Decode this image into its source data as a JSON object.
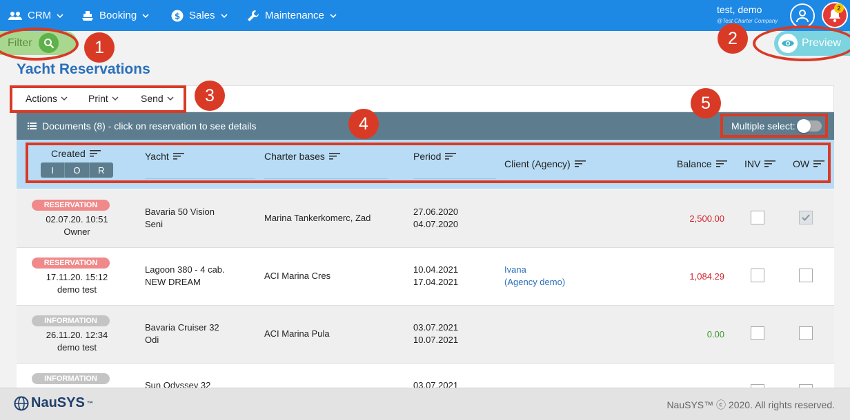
{
  "nav": {
    "items": [
      {
        "label": "CRM",
        "icon": "people-icon"
      },
      {
        "label": "Booking",
        "icon": "ship-icon"
      },
      {
        "label": "Sales",
        "icon": "dollar-icon"
      },
      {
        "label": "Maintenance",
        "icon": "wrench-icon"
      }
    ],
    "user_name": "test, demo",
    "user_company": "@Test Charter Company",
    "notification_count": "2"
  },
  "filter_label": "Filter",
  "preview_label": "Preview",
  "page_title": "Yacht Reservations",
  "toolbar": {
    "actions": "Actions",
    "print": "Print",
    "send": "Send"
  },
  "documents_header": "Documents (8) - click on reservation to see details",
  "multiple_select_label": "Multiple select:",
  "columns": {
    "created": "Created",
    "yacht": "Yacht",
    "charter_bases": "Charter bases",
    "period": "Period",
    "client": "Client (Agency)",
    "balance": "Balance",
    "inv": "INV",
    "ow": "OW"
  },
  "ior": [
    "I",
    "O",
    "R"
  ],
  "rows": [
    {
      "status": "RESERVATION",
      "created_date": "02.07.20. 10:51",
      "created_by": "Owner",
      "yacht_1": "Bavaria 50 Vision",
      "yacht_2": "Seni",
      "base": "Marina Tankerkomerc, Zad",
      "period_from": "27.06.2020",
      "period_to": "04.07.2020",
      "client_1": "",
      "client_2": "",
      "balance": "2,500.00",
      "inv": false,
      "ow": true
    },
    {
      "status": "RESERVATION",
      "created_date": "17.11.20. 15:12",
      "created_by": "demo test",
      "yacht_1": "Lagoon 380 - 4 cab.",
      "yacht_2": "NEW DREAM",
      "base": "ACI Marina Cres",
      "period_from": "10.04.2021",
      "period_to": "17.04.2021",
      "client_1": "Ivana",
      "client_2": "(Agency demo)",
      "balance": "1,084.29",
      "inv": false,
      "ow": false
    },
    {
      "status": "INFORMATION",
      "created_date": "26.11.20. 12:34",
      "created_by": "demo test",
      "yacht_1": "Bavaria Cruiser 32",
      "yacht_2": "Odi",
      "base": "ACI Marina Pula",
      "period_from": "03.07.2021",
      "period_to": "10.07.2021",
      "client_1": "",
      "client_2": "",
      "balance": "0.00",
      "inv": false,
      "ow": false
    },
    {
      "status": "INFORMATION",
      "created_date": "",
      "created_by": "",
      "yacht_1": "Sun Odyssey 32",
      "yacht_2": "",
      "base": "",
      "period_from": "03.07.2021",
      "period_to": "",
      "client_1": "",
      "client_2": "",
      "balance": "",
      "inv": false,
      "ow": false
    }
  ],
  "footer": {
    "logo": "NauSYS",
    "logo_mark": "™",
    "copyright": "NauSYS™ ⓒ 2020. All rights reserved."
  },
  "annotations": [
    "1",
    "2",
    "3",
    "4",
    "5"
  ],
  "colors": {
    "nav": "#1e88e5",
    "accent": "#2a6fba",
    "annotation": "#d93a25",
    "negative": "#d0242b",
    "positive": "#3a9a2e"
  }
}
